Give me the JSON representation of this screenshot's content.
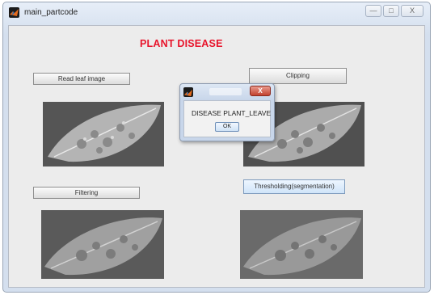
{
  "window": {
    "title": "main_partcode",
    "icon": "matlab-icon",
    "controls": {
      "minimize": "—",
      "maximize": "□",
      "close": "X"
    }
  },
  "main": {
    "heading": "PLANT DISEASE",
    "heading_color": "#e8132a",
    "buttons": {
      "read_leaf": "Read leaf image",
      "clipping": "Clipping",
      "filtering": "Filtering",
      "thresholding": "Thresholding(segmentation)"
    },
    "panels": [
      "original-leaf-image",
      "clipped-leaf-image",
      "filtered-leaf-image",
      "segmented-leaf-image"
    ]
  },
  "dialog": {
    "message": "DISEASE PLANT_LEAVE",
    "ok_label": "OK",
    "close_label": "X"
  }
}
